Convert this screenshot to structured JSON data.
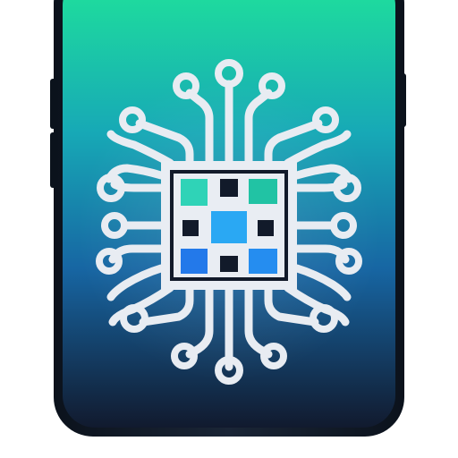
{
  "device": {
    "type": "smartphone",
    "frame_color": "#0f1826",
    "screen_gradient": [
      "#1fe39a",
      "#17a9b6",
      "#1766a3",
      "#111a2e"
    ]
  },
  "app_icon": {
    "icon_name": "ai-chip-circuit-icon",
    "trace_color": "#e8ecf2",
    "chip_frame_color": "#e9edf3",
    "chip_inner_color": "#121a2a",
    "grid_cell_colors": {
      "top_left": "#2fd3b7",
      "top_right": "#21c3a4",
      "center": "#2aa8f3",
      "bottom_left": "#2379ea",
      "bottom_right": "#258df0",
      "dark_cells": "#121a2a"
    }
  }
}
